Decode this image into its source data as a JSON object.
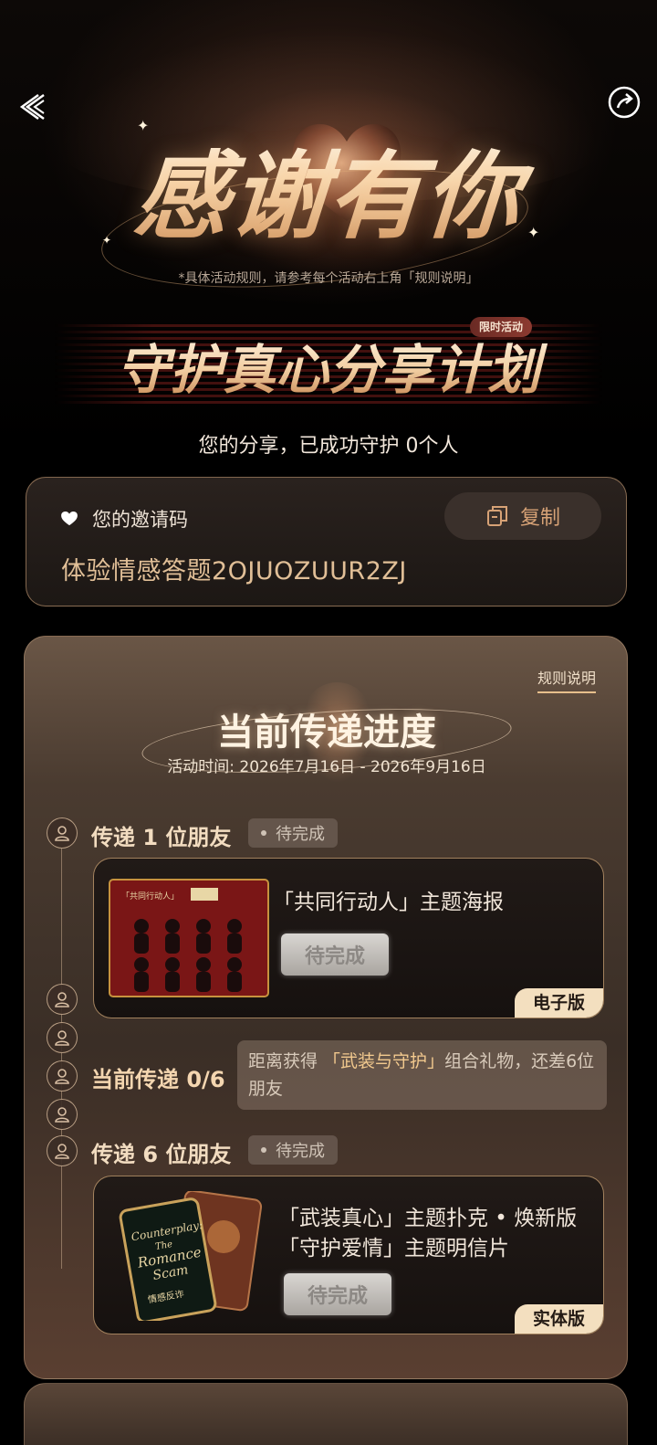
{
  "hero": {
    "main_title": "感谢有你",
    "rule_note": "*具体活动规则，请参考每个活动右上角「规则说明」",
    "sub_title": "守护真心分享计划",
    "limited_tag": "限时活动",
    "share_status": "您的分享，已成功守护 0个人"
  },
  "invite": {
    "label": "您的邀请码",
    "copy_label": "复制",
    "code": "体验情感答题2OJUOZUUR2ZJ"
  },
  "progress": {
    "rules_link": "规则说明",
    "title": "当前传递进度",
    "time": "活动时间: 2026年7月16日 - 2026年9月16日",
    "current_label": "当前传递 0/6",
    "current_progress": {
      "done": 0,
      "total": 6
    },
    "hint_pre": "距离获得 ",
    "hint_highlight": "「武装与守护」",
    "hint_post": "组合礼物，还差6位朋友",
    "steps": [
      {
        "title": "传递 1 位朋友",
        "status": "待完成",
        "reward_lines": [
          "「共同行动人」主题海报"
        ],
        "button": "待完成",
        "version": "电子版",
        "poster_text": "「共同行动人」"
      },
      {
        "title": "传递 6 位朋友",
        "status": "待完成",
        "reward_lines": [
          "「武装真心」主题扑克 • 焕新版",
          "「守护爱情」主题明信片"
        ],
        "button": "待完成",
        "version": "实体版",
        "card_text": [
          "Counterplay:",
          "The",
          "Romance",
          "Scam",
          "情感反诈"
        ]
      }
    ]
  },
  "colors": {
    "accent_gold": "#d7a276",
    "card_border": "#d7aa7d",
    "tag_bg": "#f3dfbf"
  },
  "icons": [
    "back-icon",
    "share-icon",
    "heart-icon",
    "copy-icon",
    "user-icon"
  ]
}
